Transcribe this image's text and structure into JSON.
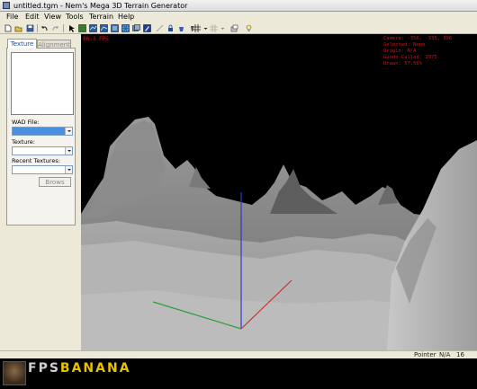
{
  "window": {
    "title": "untitled.tgm - Nem's Mega 3D Terrain Generator"
  },
  "menu": [
    "File",
    "Edit",
    "View",
    "Tools",
    "Terrain",
    "Help"
  ],
  "toolbar": {
    "icons": [
      "new-icon",
      "open-icon",
      "save-icon",
      "undo-icon",
      "redo-icon",
      "pointer-icon",
      "texture-icon",
      "grid-tool-icon",
      "vertex-tool-icon",
      "face-tool-icon",
      "select-icon",
      "image-icon",
      "pen-icon",
      "lock-icon",
      "bucket-icon",
      "light-icon",
      "grid-icon",
      "dropdown-icon",
      "snap-grid-icon",
      "dropdown-icon",
      "export-icon",
      "lightbulb-icon"
    ]
  },
  "panel": {
    "tabs": [
      "Texture",
      "Alignment"
    ],
    "wad_label": "WAD File:",
    "texture_label": "Texture:",
    "recent_label": "Recent Textures:",
    "browse_label": "Brows"
  },
  "viewport": {
    "fps": "86.3 FPS",
    "camera": "Camera: -356, -335, 396",
    "selected": "Selected: None",
    "origin": "Origin: N/A",
    "gundo_calls": "Gundo Called: 2975",
    "drawn": "Drawn: 57.56%"
  },
  "status": {
    "mode": "Pointer",
    "value": "N/A",
    "number": "16"
  },
  "branding": {
    "logo_a": "FPS",
    "logo_b": "BANANA"
  },
  "colors": {
    "axis_x": "#c83030",
    "axis_y": "#2e9e3a",
    "axis_z": "#2a3cc8",
    "hud": "#c41a1a",
    "brand": "#e6c200"
  }
}
